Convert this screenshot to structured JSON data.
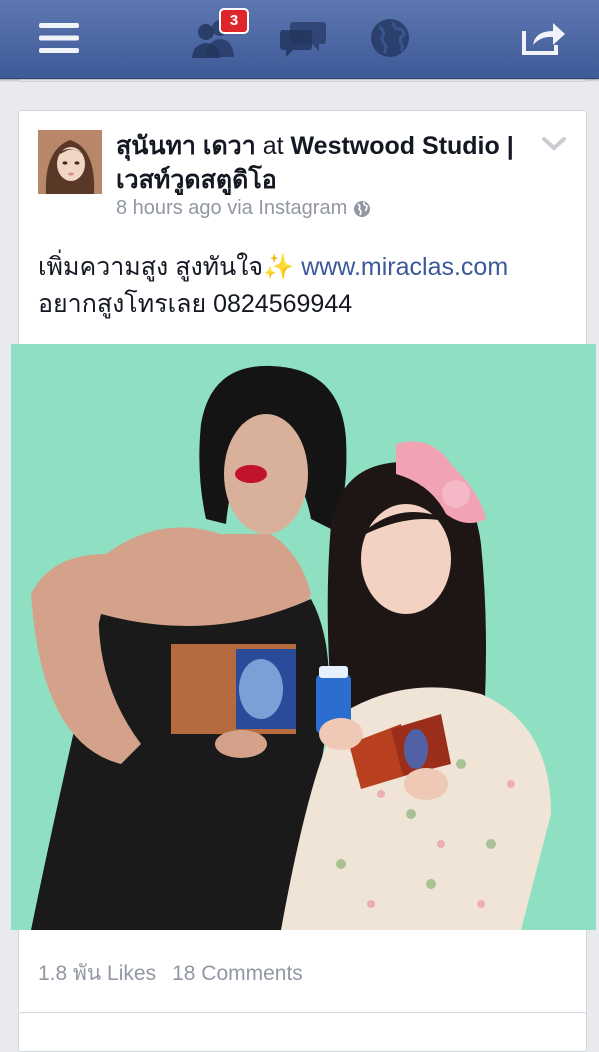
{
  "topbar": {
    "friend_requests_badge": "3",
    "icons": [
      "menu-icon",
      "friends-icon",
      "messages-icon",
      "globe-icon",
      "share-icon"
    ]
  },
  "post": {
    "author": "สุนันทา เดวา",
    "connector": "at",
    "place": "Westwood Studio | เวสท์วูดสตูดิโอ",
    "time": "8 hours ago via Instagram",
    "text_line1": "เพิ่มความสูง สูงทันใจ",
    "sparkle": "✨",
    "link": "www.miraclas.com",
    "text_line2": "อยากสูงโทรเลย 0824569944",
    "likes": "1.8 พัน Likes",
    "comments": "18 Comments"
  },
  "colors": {
    "bar": "#3e5a98",
    "photo_bg": "#8fe0c3",
    "link": "#3b5998",
    "meta_text": "#9197a3"
  }
}
